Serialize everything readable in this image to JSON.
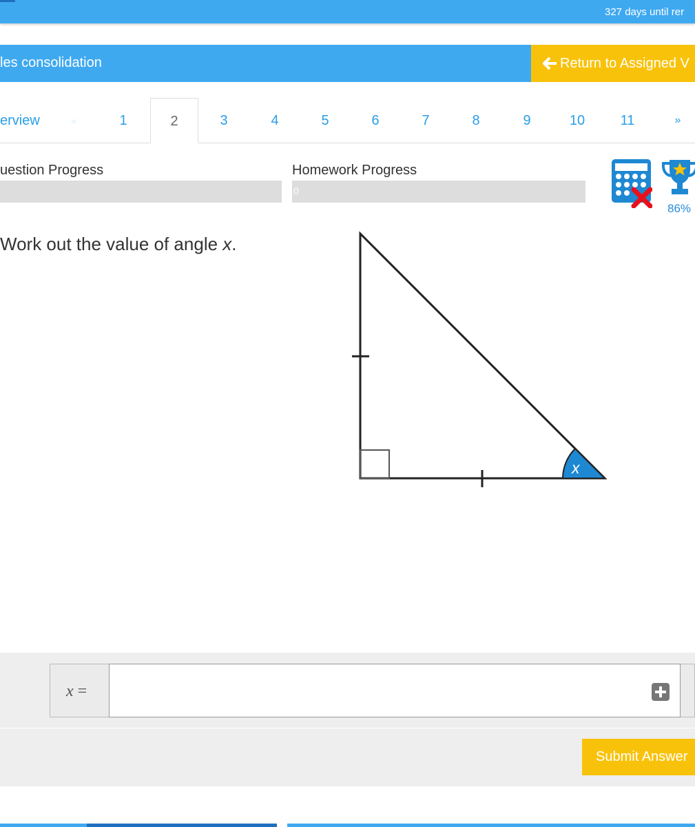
{
  "top_bar": {
    "days_text": "327 days until rer"
  },
  "title_bar": {
    "title": "les consolidation",
    "return_label": "Return to Assigned V",
    "return_icon": "arrow-left-icon"
  },
  "tabs": {
    "overview": "erview",
    "prev": "«",
    "items": [
      "1",
      "2",
      "3",
      "4",
      "5",
      "6",
      "7",
      "8",
      "9",
      "10",
      "11"
    ],
    "active": "2",
    "next": "»"
  },
  "progress": {
    "question_label": "uestion Progress",
    "question_value": 0,
    "homework_label": "Homework Progress",
    "homework_value": 0,
    "homework_text": "0"
  },
  "tools": {
    "calculator_icon": "calculator-not-allowed-icon",
    "trophy_icon": "trophy-icon",
    "score": "86%"
  },
  "question": {
    "text": "Work out the value of angle ",
    "variable": "x",
    "end": "."
  },
  "diagram": {
    "angle_label": "x",
    "accent_color": "#1e88d2"
  },
  "answer": {
    "variable": "x",
    "equals": " =",
    "value": "",
    "add_icon": "plus-square-icon",
    "submit_label": "Submit Answer"
  },
  "colors": {
    "primary": "#3fa9f0",
    "accent": "#f9c20a"
  }
}
